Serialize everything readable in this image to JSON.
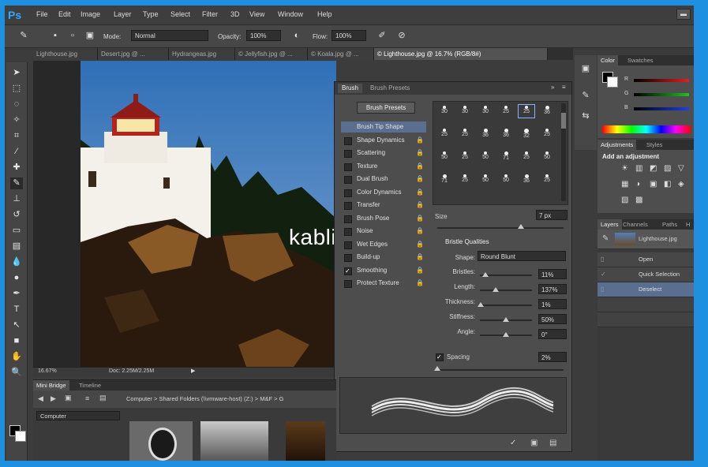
{
  "app": {
    "logo": "Ps"
  },
  "menu": [
    "File",
    "Edit",
    "Image",
    "Layer",
    "Type",
    "Select",
    "Filter",
    "3D",
    "View",
    "Window",
    "Help"
  ],
  "options": {
    "mode_label": "Mode:",
    "mode_value": "Normal",
    "opacity_label": "Opacity:",
    "opacity_value": "100%",
    "flow_label": "Flow:",
    "flow_value": "100%"
  },
  "tabs": [
    {
      "label": "Lighthouse.jpg"
    },
    {
      "label": "Desert.jpg @ ..."
    },
    {
      "label": "Hydrangeas.jpg"
    },
    {
      "label": "© Jellyfish.jpg @ ..."
    },
    {
      "label": "© Koala.jpg @ ..."
    },
    {
      "label": "© Lighthouse.jpg @ 16.7% (RGB/8#)"
    }
  ],
  "status": {
    "zoom": "16.67%",
    "doc": "Doc: 2.25M/2.25M"
  },
  "brush_panel": {
    "tabs": [
      "Brush",
      "Brush Presets"
    ],
    "presets_button": "Brush Presets",
    "items": [
      {
        "label": "Brush Tip Shape",
        "checked": false,
        "selected": true
      },
      {
        "label": "Shape Dynamics",
        "checked": false
      },
      {
        "label": "Scattering",
        "checked": false
      },
      {
        "label": "Texture",
        "checked": false
      },
      {
        "label": "Dual Brush",
        "checked": false
      },
      {
        "label": "Color Dynamics",
        "checked": false
      },
      {
        "label": "Transfer",
        "checked": false
      },
      {
        "label": "Brush Pose",
        "checked": false
      },
      {
        "label": "Noise",
        "checked": false
      },
      {
        "label": "Wet Edges",
        "checked": false
      },
      {
        "label": "Build-up",
        "checked": false
      },
      {
        "label": "Smoothing",
        "checked": true
      },
      {
        "label": "Protect Texture",
        "checked": false
      }
    ],
    "tip_sizes": [
      "30",
      "30",
      "30",
      "25",
      "25",
      "36",
      "25",
      "25",
      "36",
      "36",
      "32",
      "25",
      "50",
      "25",
      "50",
      "71",
      "25",
      "50",
      "71",
      "25",
      "50",
      "50",
      "36",
      "25"
    ],
    "size_label": "Size",
    "size_value": "7 px",
    "qualities_title": "Bristle Qualities",
    "shape_label": "Shape:",
    "shape_value": "Round Blunt",
    "props": [
      {
        "label": "Bristles:",
        "value": "11%",
        "level": 0.11
      },
      {
        "label": "Length:",
        "value": "137%",
        "level": 0.3
      },
      {
        "label": "Thickness:",
        "value": "1%",
        "level": 0.01
      },
      {
        "label": "Stiffness:",
        "value": "50%",
        "level": 0.5
      },
      {
        "label": "Angle:",
        "value": "0°",
        "level": 0.5
      }
    ],
    "spacing_label": "Spacing",
    "spacing_value": "2%"
  },
  "color_panel": {
    "tabs": [
      "Color",
      "Swatches"
    ],
    "channels": [
      "R",
      "G",
      "B"
    ]
  },
  "adjustments": {
    "tabs": [
      "Adjustments",
      "Styles"
    ],
    "title": "Add an adjustment"
  },
  "layers": {
    "tabs": [
      "Layers",
      "Channels",
      "Paths",
      "H"
    ],
    "layer_name": "Lighthouse.jpg"
  },
  "history": {
    "items": [
      "Open",
      "Quick Selection",
      "Deselect"
    ]
  },
  "bridge": {
    "tabs": [
      "Mini Bridge",
      "Timeline"
    ],
    "path": "Computer > Shared Folders (\\\\vmware-host) (Z:) > M&F > G",
    "location": "Computer"
  },
  "watermark": "kablistore",
  "colors": {
    "accent": "#31a8ff",
    "frame": "#1f8fe0",
    "panel": "#4d4d4d"
  }
}
